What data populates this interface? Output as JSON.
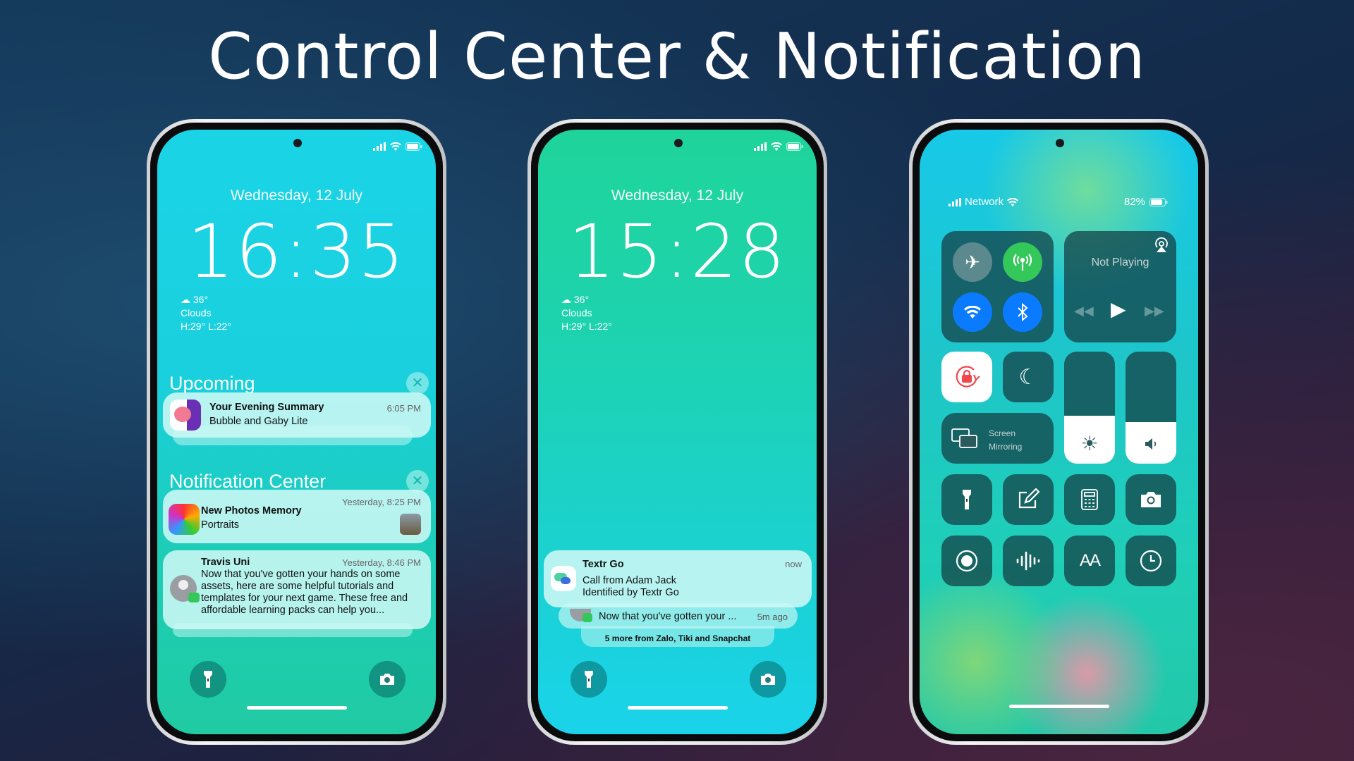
{
  "page_title": "Control Center & Notification",
  "colors": {
    "accent_green": "#34c759",
    "accent_blue": "#0a7bff",
    "lock_red": "#f2464e"
  },
  "phone1": {
    "date": "Wednesday, 12 July",
    "time": "16:35",
    "weather": {
      "icon": "cloud-icon",
      "temp": "36°",
      "condition": "Clouds",
      "range": "H:29° L:22°"
    },
    "upcoming": {
      "header": "Upcoming",
      "close_icon": "close-icon",
      "notification": {
        "title": "Your Evening Summary",
        "body": "Bubble and Gaby Lite",
        "time": "6:05 PM"
      }
    },
    "notification_center": {
      "header": "Notification Center",
      "close_icon": "close-icon",
      "notifications": [
        {
          "title": "New Photos Memory",
          "body": "Portraits",
          "time": "Yesterday, 8:25 PM"
        },
        {
          "title": "Travis Uni",
          "body": "Now that you've gotten your hands on some assets, here are some helpful tutorials and templates for your next game. These free and affordable learning packs can help you...",
          "time": "Yesterday, 8:46 PM"
        }
      ]
    }
  },
  "phone2": {
    "date": "Wednesday, 12 July",
    "time": "15:28",
    "weather": {
      "icon": "cloud-icon",
      "temp": "36°",
      "condition": "Clouds",
      "range": "H:29° L:22°"
    },
    "notification": {
      "app": "Textr Go",
      "line1": "Call from Adam Jack",
      "line2": "Identified by Textr Go",
      "time": "now"
    },
    "stacked": {
      "body": "Now that you've gotten your ...",
      "time": "5m ago"
    },
    "more": "5 more from Zalo, Tiki and Snapchat"
  },
  "phone3": {
    "carrier": "Network",
    "battery": "82%",
    "connectivity": {
      "airplane": false,
      "cellular": true,
      "wifi": true,
      "bluetooth": true
    },
    "media": {
      "status": "Not Playing"
    },
    "screen_mirroring": {
      "line1": "Screen",
      "line2": "Mirroring"
    },
    "brightness_percent": 43,
    "volume_percent": 37,
    "aa_label": "AA"
  }
}
